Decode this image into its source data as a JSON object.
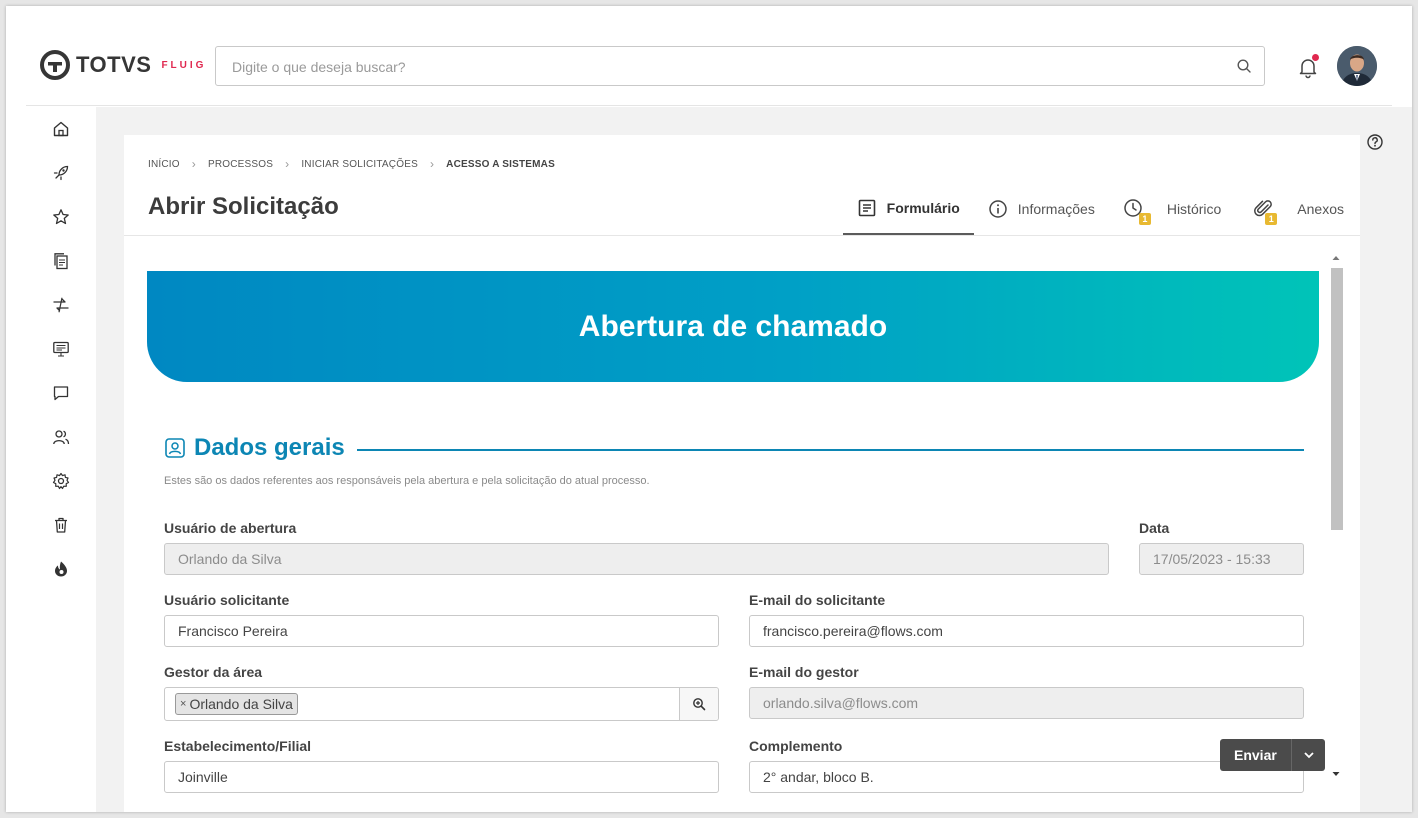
{
  "brand": {
    "name": "TOTVS",
    "product": "FLUIG",
    "accent": "#e0284f"
  },
  "search": {
    "placeholder": "Digite o que deseja buscar?"
  },
  "sidebar": {
    "items": [
      {
        "icon": "home-icon"
      },
      {
        "icon": "rocket-icon"
      },
      {
        "icon": "star-icon",
        "has_submenu": true
      },
      {
        "icon": "documents-icon"
      },
      {
        "icon": "workflow-icon",
        "has_submenu": true
      },
      {
        "icon": "monitor-icon"
      },
      {
        "icon": "chat-icon"
      },
      {
        "icon": "users-icon"
      },
      {
        "icon": "gear-icon"
      },
      {
        "icon": "trash-icon"
      },
      {
        "icon": "fluig-flame-icon"
      }
    ]
  },
  "breadcrumb": [
    "INÍCIO",
    "PROCESSOS",
    "INICIAR SOLICITAÇÕES",
    "ACESSO A SISTEMAS"
  ],
  "page": {
    "title": "Abrir Solicitação"
  },
  "tabs": [
    {
      "label": "Formulário",
      "active": true
    },
    {
      "label": "Informações"
    },
    {
      "label": "Histórico",
      "badge": "1"
    },
    {
      "label": "Anexos",
      "badge": "1"
    }
  ],
  "banner": {
    "title": "Abertura de chamado"
  },
  "section": {
    "title": "Dados gerais",
    "description": "Estes são os dados referentes aos responsáveis pela abertura e pela solicitação do atual processo."
  },
  "form": {
    "usuario_abertura": {
      "label": "Usuário de abertura",
      "value": "Orlando da Silva"
    },
    "data": {
      "label": "Data",
      "value": "17/05/2023 - 15:33"
    },
    "usuario_solicitante": {
      "label": "Usuário solicitante",
      "value": "Francisco Pereira"
    },
    "email_solicitante": {
      "label": "E-mail do solicitante",
      "value": "francisco.pereira@flows.com"
    },
    "gestor_area": {
      "label": "Gestor da área",
      "tag": "Orlando da Silva",
      "tag_remove": "×"
    },
    "email_gestor": {
      "label": "E-mail do gestor",
      "value": "orlando.silva@flows.com"
    },
    "estabelecimento": {
      "label": "Estabelecimento/Filial",
      "value": "Joinville"
    },
    "complemento": {
      "label": "Complemento",
      "value": "2° andar, bloco B."
    }
  },
  "actions": {
    "send_label": "Enviar"
  },
  "colors": {
    "primary": "#0c86b4",
    "banner_start": "#0088c2",
    "banner_end": "#00c4b8",
    "badge": "#e8b931"
  }
}
